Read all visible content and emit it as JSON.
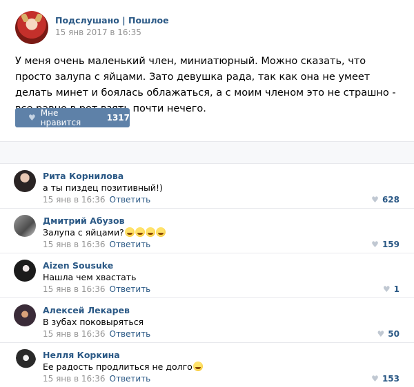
{
  "post": {
    "author": "Подслушано | Пошлое",
    "date": "15 янв 2017 в 16:35",
    "text": "У меня очень маленький член, миниатюрный. Можно сказать, что просто залупа с яйцами. Зато девушка рада, так как она не умеет делать минет и боялась облажаться, а с моим членом это не страшно - все равно в рот взять почти нечего.",
    "like_label": "Мне нравится",
    "like_count": "1317"
  },
  "comments": [
    {
      "author": "Рита Корнилова",
      "text": "а ты пиздец позитивный!)",
      "date": "15 янв в 16:36",
      "reply": "Ответить",
      "likes": "628"
    },
    {
      "author": "Дмитрий Абузов",
      "text": "Залупа с яйцами?",
      "emoji_count": 4,
      "date": "15 янв в 16:36",
      "reply": "Ответить",
      "likes": "159"
    },
    {
      "author": "Aizen Sousuke",
      "text": "Нашла чем хвастать",
      "date": "15 янв в 16:36",
      "reply": "Ответить",
      "likes": "1"
    },
    {
      "author": "Алексей Лекарев",
      "text": "В зубах поковыряться",
      "date": "15 янв в 16:36",
      "reply": "Ответить",
      "likes": "50"
    },
    {
      "author": "Нелля Коркина",
      "text": "Ее радость продлиться не долго",
      "emoji_count": 1,
      "date": "15 янв в 16:36",
      "reply": "Ответить",
      "likes": "153"
    }
  ],
  "icons": {
    "like": "heart-icon"
  }
}
